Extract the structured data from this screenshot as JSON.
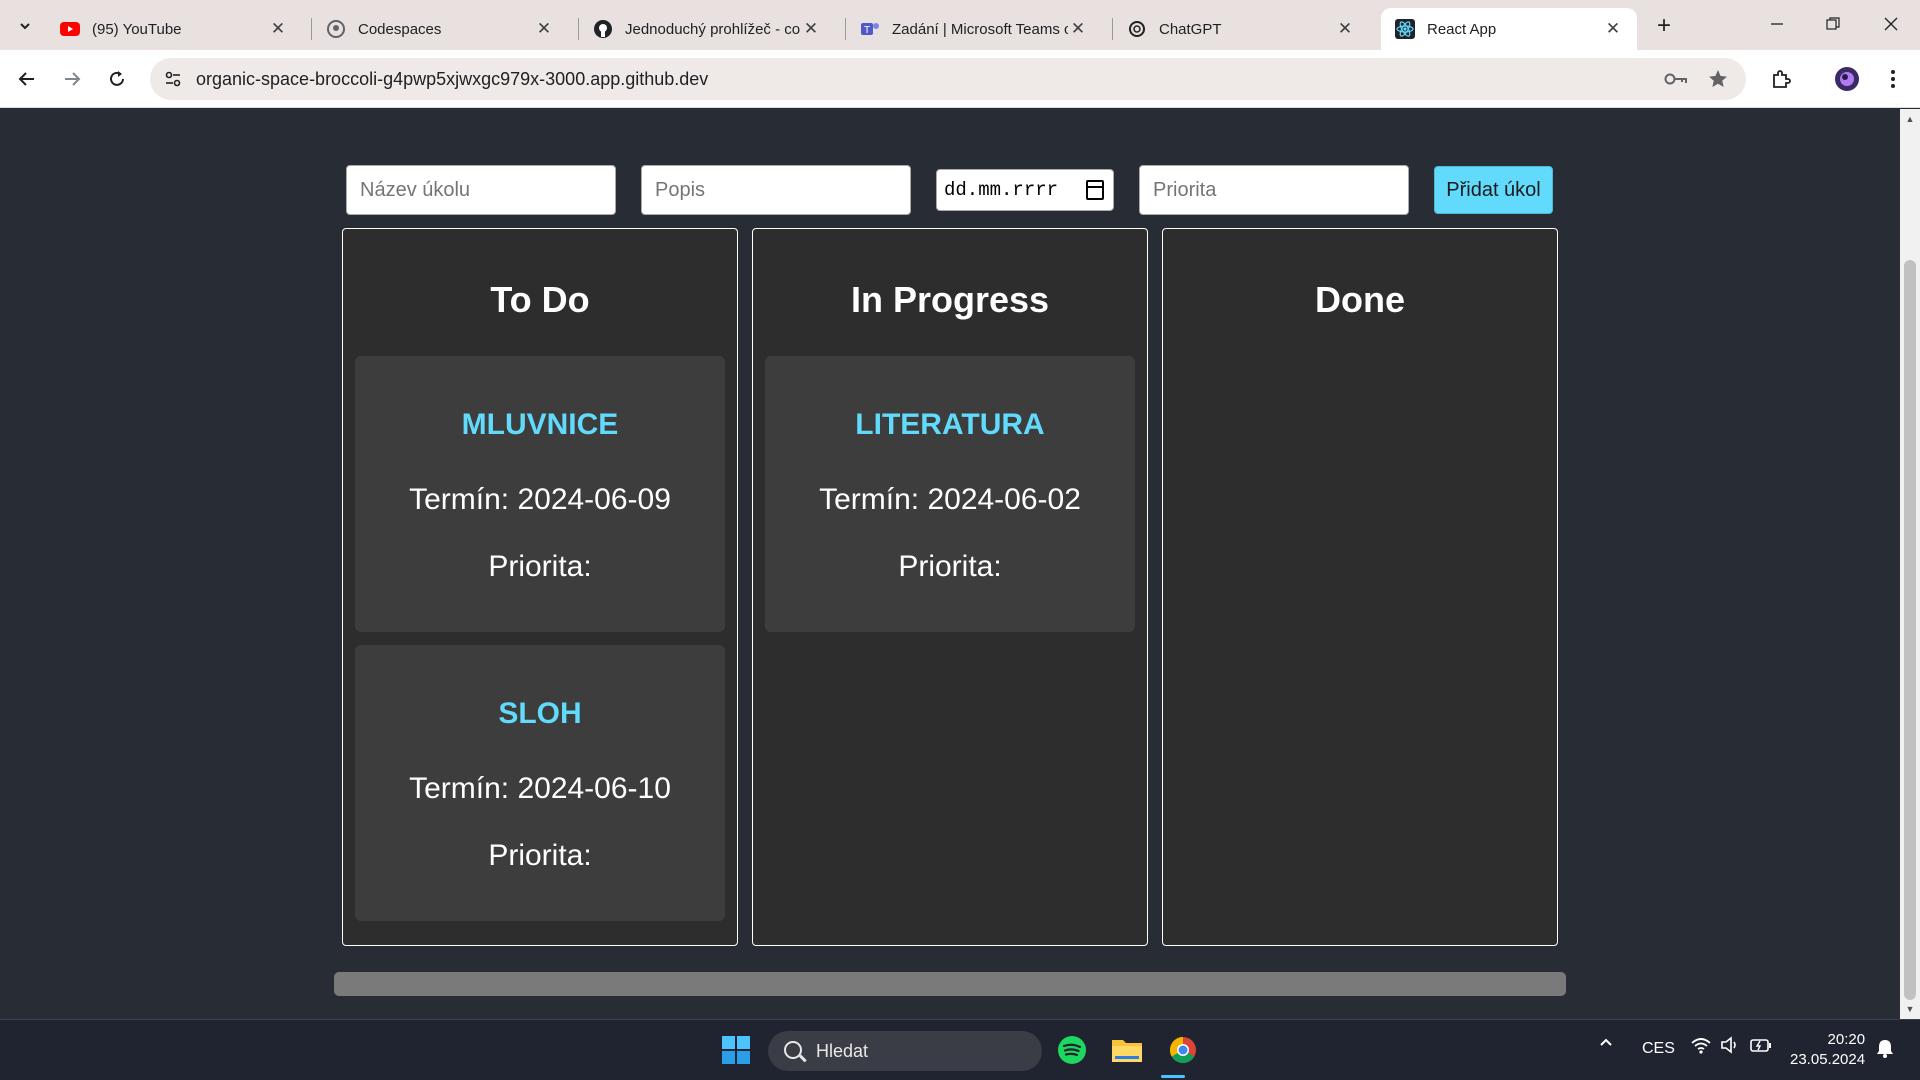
{
  "browser": {
    "tabs": [
      {
        "title": "(95) YouTube",
        "icon": "youtube-icon",
        "active": false
      },
      {
        "title": "Codespaces",
        "icon": "github-icon",
        "active": false
      },
      {
        "title": "Jednoduchý prohlížeč - co",
        "icon": "github-icon",
        "active": false
      },
      {
        "title": "Zadání | Microsoft Teams c",
        "icon": "teams-icon",
        "active": false
      },
      {
        "title": "ChatGPT",
        "icon": "chatgpt-icon",
        "active": false
      },
      {
        "title": "React App",
        "icon": "react-icon",
        "active": true
      }
    ],
    "url": "organic-space-broccoli-g4pwp5xjwxgc979x-3000.app.github.dev"
  },
  "form": {
    "name_placeholder": "Název úkolu",
    "description_placeholder": "Popis",
    "date_value": "dd.mm.rrrr",
    "priority_placeholder": "Priorita",
    "add_button": "Přidat úkol"
  },
  "board": {
    "columns": [
      {
        "title": "To Do",
        "tasks": [
          {
            "name": "MLUVNICE",
            "due": "Termín: 2024-06-09",
            "priority": "Priorita:"
          },
          {
            "name": "SLOH",
            "due": "Termín: 2024-06-10",
            "priority": "Priorita:"
          }
        ]
      },
      {
        "title": "In Progress",
        "tasks": [
          {
            "name": "LITERATURA",
            "due": "Termín: 2024-06-02",
            "priority": "Priorita:"
          }
        ]
      },
      {
        "title": "Done",
        "tasks": []
      }
    ]
  },
  "taskbar": {
    "search_label": "Hledat",
    "language": "CES",
    "time": "20:20",
    "date": "23.05.2024"
  },
  "colors": {
    "accent": "#61dafb",
    "page_background": "#282c34",
    "column_background": "#2d2d2d",
    "card_background": "#3d3d3d"
  }
}
